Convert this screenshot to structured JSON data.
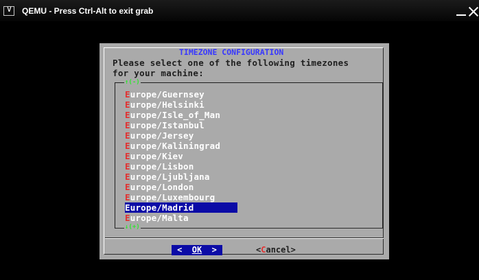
{
  "window": {
    "title": "QEMU - Press Ctrl-Alt to exit grab",
    "menu_glyph": "∨"
  },
  "dialog": {
    "title": "TIMEZONE CONFIGURATION",
    "prompt_line1": "Please select one of the following timezones",
    "prompt_line2": "for your machine:",
    "scroll_up": "↑(-)",
    "scroll_down": "↓(+)",
    "items": [
      {
        "hot": "E",
        "rest": "urope/Guernsey"
      },
      {
        "hot": "E",
        "rest": "urope/Helsinki"
      },
      {
        "hot": "E",
        "rest": "urope/Isle_of_Man"
      },
      {
        "hot": "E",
        "rest": "urope/Istanbul"
      },
      {
        "hot": "E",
        "rest": "urope/Jersey"
      },
      {
        "hot": "E",
        "rest": "urope/Kaliningrad"
      },
      {
        "hot": "E",
        "rest": "urope/Kiev"
      },
      {
        "hot": "E",
        "rest": "urope/Lisbon"
      },
      {
        "hot": "E",
        "rest": "urope/Ljubljana"
      },
      {
        "hot": "E",
        "rest": "urope/London"
      },
      {
        "hot": "E",
        "rest": "urope/Luxembourg"
      },
      {
        "hot": "E",
        "rest": "urope/Madrid"
      },
      {
        "hot": "E",
        "rest": "urope/Malta"
      }
    ],
    "selected_index": 11,
    "ok_button": {
      "left": "<  ",
      "label": "OK",
      "right": "  >"
    },
    "cancel_button": {
      "open": "<",
      "hot": "C",
      "rest": "ancel>"
    }
  },
  "colors": {
    "dialog_bg": "#aaaaaa",
    "title": "#3838ff",
    "hotkey": "#e23030",
    "selection": "#0b0ba6",
    "scroll_indicator": "#2ee82e"
  }
}
